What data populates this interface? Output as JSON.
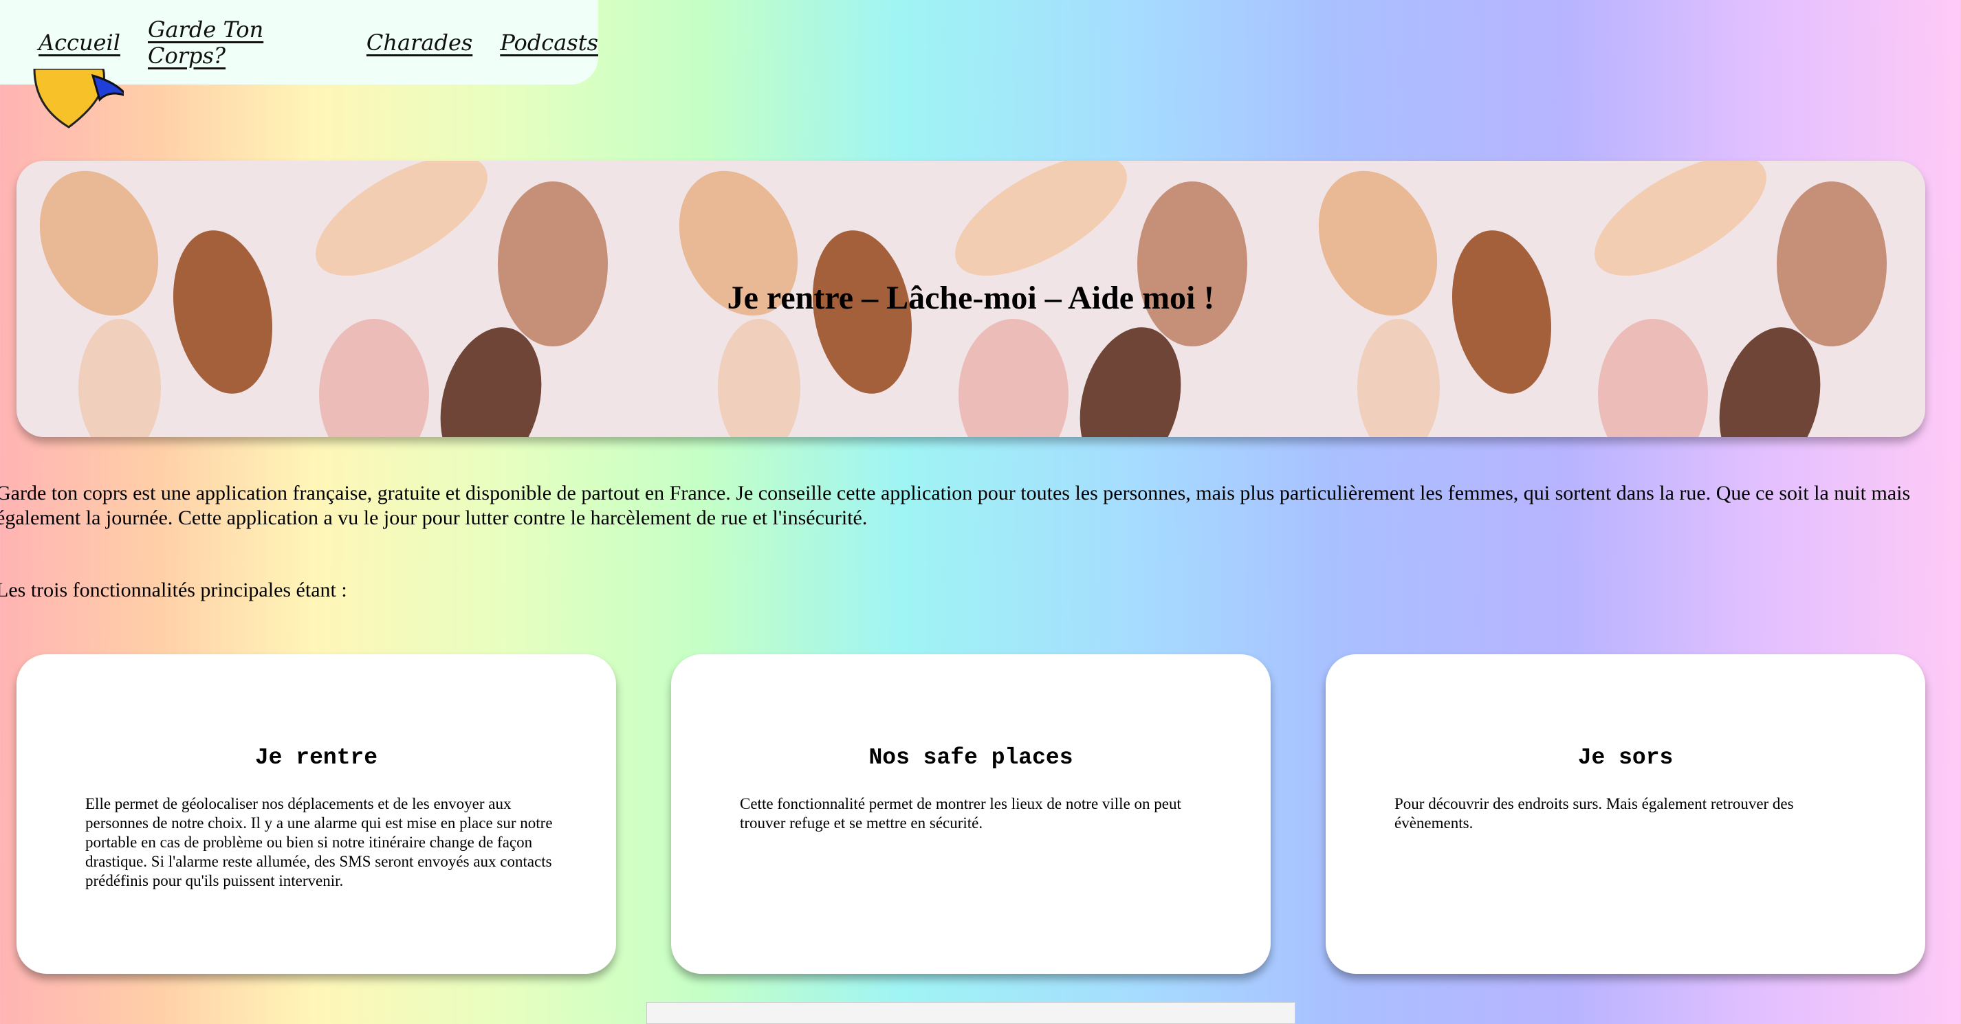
{
  "nav": {
    "items": [
      {
        "label": "Accueil"
      },
      {
        "label": "Garde Ton Corps?"
      },
      {
        "label": "Charades"
      },
      {
        "label": "Podcasts"
      }
    ]
  },
  "hero": {
    "title": "Je rentre – Lâche-moi – Aide moi !"
  },
  "intro": {
    "text": "Garde ton coprs est une application française, gratuite et disponible de partout en France. Je conseille cette application pour toutes les personnes, mais plus particulièrement les femmes, qui sortent dans la rue. Que ce soit la nuit mais également la journée. Cette application a vu le jour pour lutter contre le harcèlement de rue et l'insécurité.",
    "lead": "Les trois fonctionnalités principales étant :"
  },
  "features": [
    {
      "title": "Je rentre",
      "text": "Elle permet de géolocaliser nos déplacements et de les envoyer aux personnes de notre choix. Il y a une alarme qui est mise en place sur notre portable en cas de problème ou bien si notre itinéraire change de façon drastique. Si l'alarme reste allumée, des SMS seront envoyés aux contacts prédéfinis pour qu'ils puissent intervenir."
    },
    {
      "title": "Nos safe places",
      "text": "Cette fonctionnalité permet de montrer les lieux de notre ville on peut trouver refuge et se mettre en sécurité."
    },
    {
      "title": "Je sors",
      "text": "Pour découvrir des endroits surs. Mais également retrouver des évènements."
    }
  ],
  "colors": {
    "nav_bg": "#f0fff8",
    "hero_bg": "#f0e4e7",
    "card_bg": "#ffffff"
  }
}
